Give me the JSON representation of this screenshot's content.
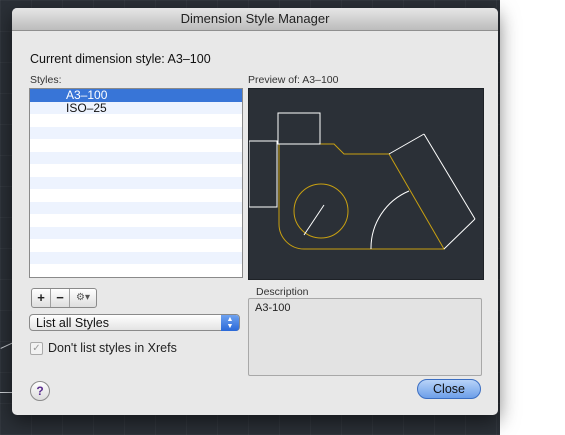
{
  "window": {
    "title": "Dimension Style Manager"
  },
  "current_style": "Current dimension style: A3–100",
  "styles": {
    "label": "Styles:",
    "items": [
      "A3–100",
      "ISO–25"
    ],
    "selected": "A3–100"
  },
  "preview": {
    "label": "Preview of: A3–100"
  },
  "toolbar": {
    "add": "+",
    "remove": "−",
    "gear": "⚙▾"
  },
  "filter": {
    "selected": "List all Styles"
  },
  "xref_checkbox": {
    "label": "Don't list styles in Xrefs",
    "checked": true
  },
  "description": {
    "label": "Description",
    "value": "A3-100"
  },
  "buttons": {
    "help": "?",
    "close": "Close"
  },
  "icons": [
    "plus-icon",
    "minus-icon",
    "gear-icon",
    "chevron-updown-icon",
    "checkmark-icon",
    "help-icon"
  ],
  "colors": {
    "accent": "#3875d7",
    "preview_bg": "#2b3037",
    "geometry": "#c8a011",
    "lines": "#ffffff"
  }
}
